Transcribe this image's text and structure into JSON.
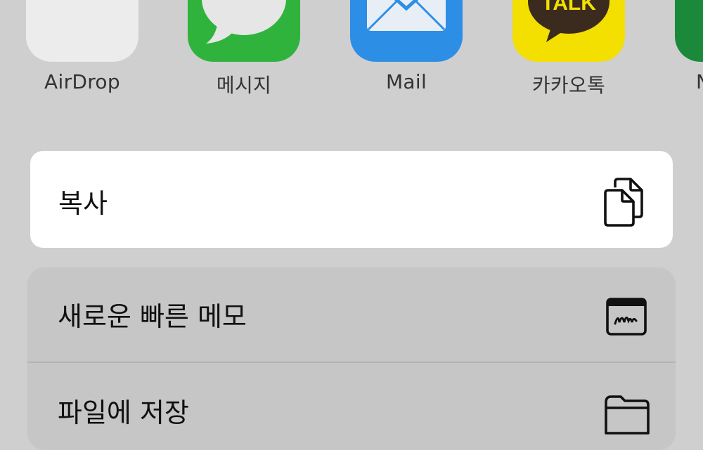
{
  "apps": [
    {
      "label": "AirDrop",
      "icon": "airdrop-icon"
    },
    {
      "label": "메시지",
      "icon": "messages-icon"
    },
    {
      "label": "Mail",
      "icon": "mail-icon"
    },
    {
      "label": "카카오톡",
      "icon": "kakaotalk-icon",
      "icon_text": "TALK"
    },
    {
      "label": "N",
      "icon": "partial-app-icon"
    }
  ],
  "copy": {
    "label": "복사",
    "icon": "copy-icon"
  },
  "actions": [
    {
      "label": "새로운 빠른 메모",
      "icon": "quick-note-icon"
    },
    {
      "label": "파일에 저장",
      "icon": "folder-icon"
    }
  ],
  "colors": {
    "dimmed_background": "#cfcfcf",
    "highlighted_card": "#ffffff",
    "messages_green": "#2fb33d",
    "mail_blue": "#2d8ee6",
    "kakao_yellow": "#f3df00",
    "airdrop_blue": "#1d7fe3"
  }
}
